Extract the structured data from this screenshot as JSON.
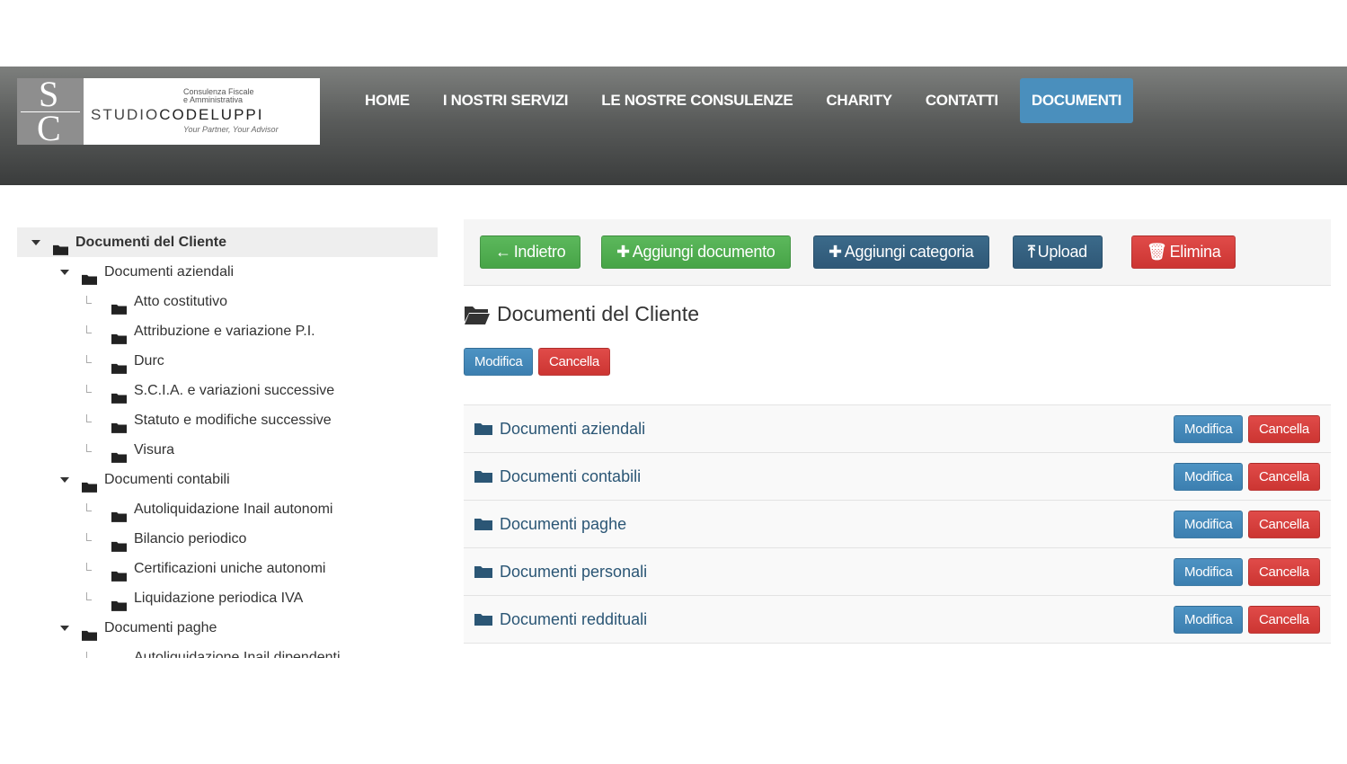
{
  "logo": {
    "mono_top": "S",
    "mono_bottom": "C",
    "tagline_1": "Consulenza Fiscale",
    "tagline_2": "e Amministrativa",
    "brand_a": "STUDIO",
    "brand_b": "CODELUPPI",
    "motto": "Your Partner, Your Advisor"
  },
  "nav": {
    "items": [
      {
        "label": "HOME"
      },
      {
        "label": "I NOSTRI SERVIZI"
      },
      {
        "label": "LE NOSTRE CONSULENZE"
      },
      {
        "label": "CHARITY"
      },
      {
        "label": "CONTATTI"
      },
      {
        "label": "DOCUMENTI",
        "active": true
      }
    ]
  },
  "tree": {
    "root": "Documenti del Cliente",
    "groups": [
      {
        "label": "Documenti aziendali",
        "children": [
          "Atto costitutivo",
          "Attribuzione e variazione P.I.",
          "Durc",
          "S.C.I.A. e variazioni successive",
          "Statuto e modifiche successive",
          "Visura"
        ]
      },
      {
        "label": "Documenti contabili",
        "children": [
          "Autoliquidazione Inail autonomi",
          "Bilancio periodico",
          "Certificazioni uniche autonomi",
          "Liquidazione periodica IVA"
        ]
      },
      {
        "label": "Documenti paghe",
        "children": [
          "Autoliquidazione Inail dipendenti"
        ]
      }
    ]
  },
  "toolbar": {
    "back": "Indietro",
    "add_document": "Aggiungi documento",
    "add_category": "Aggiungi categoria",
    "upload": "Upload",
    "delete": "Elimina"
  },
  "current": {
    "title": "Documenti del Cliente",
    "edit": "Modifica",
    "remove": "Cancella"
  },
  "folders": {
    "edit": "Modifica",
    "remove": "Cancella",
    "items": [
      "Documenti aziendali",
      "Documenti contabili",
      "Documenti paghe",
      "Documenti personali",
      "Documenti reddituali"
    ]
  },
  "colors": {
    "nav_active": "#4a8fbd",
    "btn_green": "#5cb85c",
    "btn_navy": "#2f5877",
    "btn_red": "#d9534f",
    "btn_blue": "#428bca",
    "folder_link": "#2b5675"
  }
}
